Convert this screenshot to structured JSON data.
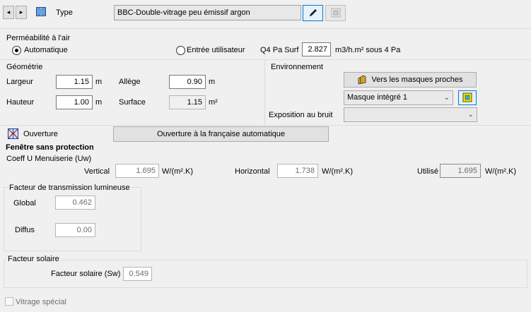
{
  "header": {
    "type_label": "Type",
    "type_value": "BBC-Double-vitrage peu émissif argon"
  },
  "air": {
    "title": "Perméabilité à l'air",
    "auto_label": "Automatique",
    "user_label": "Entrée utilisateur",
    "q4_label": "Q4 Pa Surf",
    "q4_value": "2.827",
    "q4_unit": "m3/h.m² sous 4 Pa",
    "selected": "Automatique"
  },
  "geometry": {
    "title": "Géométrie",
    "largeur_label": "Largeur",
    "largeur_value": "1.15",
    "largeur_unit": "m",
    "hauteur_label": "Hauteur",
    "hauteur_value": "1.00",
    "hauteur_unit": "m",
    "allege_label": "Allège",
    "allege_value": "0.90",
    "allege_unit": "m",
    "surface_label": "Surface",
    "surface_value": "1.15",
    "surface_unit": "m²"
  },
  "environment": {
    "title": "Environnement",
    "masks_button": "Vers les masques proches",
    "mask_select": "Masque intégré 1",
    "noise_label": "Exposition au bruit",
    "noise_value": ""
  },
  "opening": {
    "label": "Ouverture",
    "button": "Ouverture à la française automatique"
  },
  "window": {
    "title": "Fenêtre sans protection",
    "coeff_label": "Coeff U Menuiserie (Uw)",
    "vertical_label": "Vertical",
    "vertical_value": "1.695",
    "horizontal_label": "Horizontal",
    "horizontal_value": "1.738",
    "used_label": "Utilisé",
    "used_value": "1.695",
    "unit": "W/(m².K)"
  },
  "light": {
    "title": "Facteur de transmission lumineuse",
    "global_label": "Global",
    "global_value": "0.462",
    "diffus_label": "Diffus",
    "diffus_value": "0.00"
  },
  "solar": {
    "title": "Facteur solaire",
    "sw_label": "Facteur solaire (Sw)",
    "sw_value": "0.549"
  },
  "special": {
    "label": "Vitrage spécial",
    "checked": false
  },
  "colors": {
    "background": "#f0f0f0",
    "field_border": "#7a7a7a"
  }
}
